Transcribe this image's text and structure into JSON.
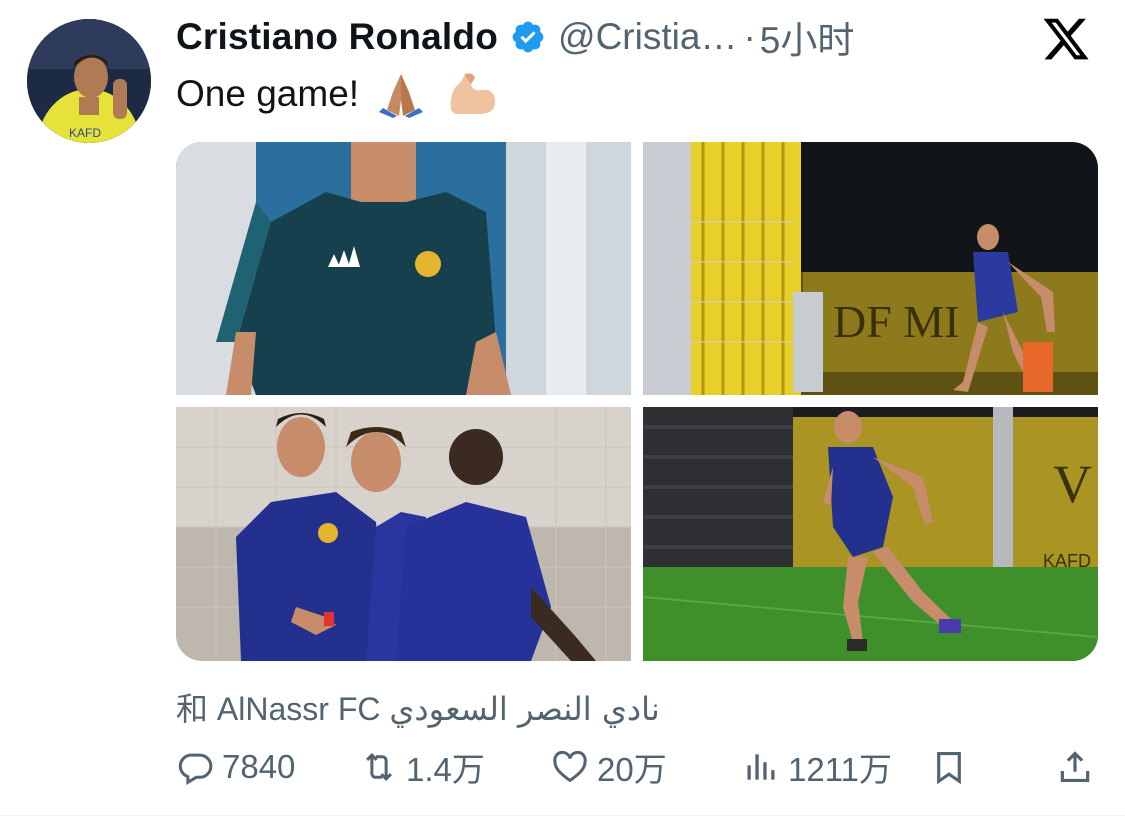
{
  "author": {
    "name": "Cristiano Ronaldo",
    "handle": "@Cristia…",
    "separator": "·",
    "time": "5小时",
    "verified": true,
    "avatar_icon": "avatar-photo"
  },
  "tweet": {
    "text": "One game!",
    "emojis": [
      "folded-hands-icon",
      "flexed-biceps-icon"
    ]
  },
  "media": {
    "images": [
      {
        "icon": "photo-player-closeup"
      },
      {
        "icon": "photo-player-training-net"
      },
      {
        "icon": "photo-players-group"
      },
      {
        "icon": "photo-player-running-pitch"
      }
    ]
  },
  "location": {
    "prefix": "和",
    "latin": "AlNassr FC",
    "arabic": "نادي النصر السعودي"
  },
  "actions": {
    "replies": "7840",
    "retweets": "1.4万",
    "likes": "20万",
    "views": "1211万"
  },
  "colors": {
    "text_primary": "#0f1419",
    "text_secondary": "#536471",
    "verified_blue": "#1d9bf0",
    "divider": "#eff3f4"
  }
}
